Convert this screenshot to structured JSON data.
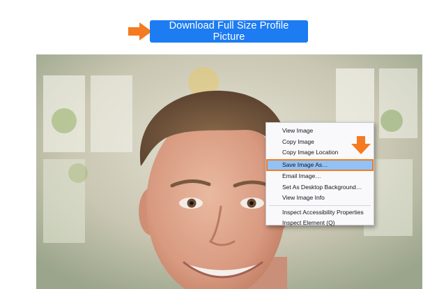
{
  "header": {
    "download_button_label": "Download Full Size Profile Picture",
    "accent_color": "#1d7cf2",
    "arrow_color": "#f47b20"
  },
  "photo": {
    "description_icon": "portrait-photo"
  },
  "context_menu": {
    "items": [
      {
        "label": "View Image"
      },
      {
        "label": "Copy Image"
      },
      {
        "label": "Copy Image Location"
      },
      {
        "label": "Save Image As…",
        "highlighted": true
      },
      {
        "label": "Email Image…"
      },
      {
        "label": "Set As Desktop Background…"
      },
      {
        "label": "View Image Info"
      },
      {
        "label": "Inspect Accessibility Properties"
      },
      {
        "label": "Inspect Element (Q)"
      }
    ],
    "highlight_color": "#91c2f7"
  }
}
